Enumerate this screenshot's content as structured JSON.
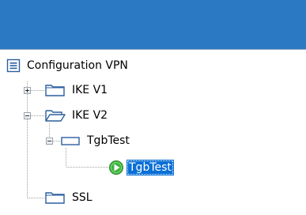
{
  "tree": {
    "root": {
      "label": "Configuration VPN",
      "icon": "config-list-icon"
    },
    "items": [
      {
        "label": "IKE V1",
        "icon": "folder-closed-icon",
        "expanded": false
      },
      {
        "label": "IKE V2",
        "icon": "folder-open-icon",
        "expanded": true
      },
      {
        "label": "TgbTest",
        "icon": "tunnel-group-icon",
        "expanded": true
      },
      {
        "label": "TgbTest",
        "icon": "play-green-icon",
        "selected": true
      },
      {
        "label": "SSL",
        "icon": "folder-closed-icon"
      }
    ]
  },
  "colors": {
    "header": "#2b79c2",
    "selection": "#0a6fd6",
    "play_icon": "#3db33d"
  }
}
